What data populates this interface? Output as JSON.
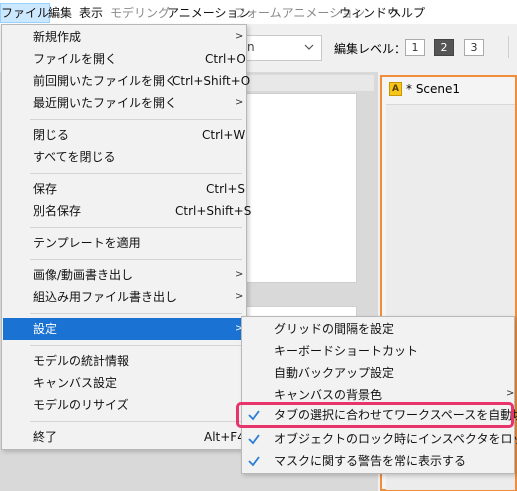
{
  "menubar": {
    "items": [
      {
        "label": "ファイル",
        "state": "active"
      },
      {
        "label": "編集",
        "state": "normal"
      },
      {
        "label": "表示",
        "state": "normal"
      },
      {
        "label": "モデリング",
        "state": "disabled"
      },
      {
        "label": "アニメーション",
        "state": "normal"
      },
      {
        "label": "フォームアニメーション",
        "state": "disabled"
      },
      {
        "label": "ウィンドウ",
        "state": "normal"
      },
      {
        "label": "ヘルプ",
        "state": "normal"
      }
    ]
  },
  "toolbar": {
    "combo_value": "n",
    "edit_level_label": "編集レベル：",
    "levels": [
      "1",
      "2",
      "3"
    ],
    "selected_level": "2"
  },
  "scene_tab": {
    "icon_letter": "A",
    "label": "* Scene1"
  },
  "file_menu": {
    "items": [
      {
        "label": "新規作成",
        "shortcut": "",
        "submenu": true
      },
      {
        "label": "ファイルを開く",
        "shortcut": "Ctrl+O",
        "submenu": false
      },
      {
        "label": "前回開いたファイルを開く",
        "shortcut": "Ctrl+Shift+O",
        "submenu": false
      },
      {
        "label": "最近開いたファイルを開く",
        "shortcut": "",
        "submenu": true
      },
      {
        "label": "閉じる",
        "shortcut": "Ctrl+W",
        "submenu": false
      },
      {
        "label": "すべてを閉じる",
        "shortcut": "",
        "submenu": false
      },
      {
        "label": "保存",
        "shortcut": "Ctrl+S",
        "submenu": false
      },
      {
        "label": "別名保存",
        "shortcut": "Ctrl+Shift+S",
        "submenu": false
      },
      {
        "label": "テンプレートを適用",
        "shortcut": "",
        "submenu": false
      },
      {
        "label": "画像/動画書き出し",
        "shortcut": "",
        "submenu": true
      },
      {
        "label": "組込み用ファイル書き出し",
        "shortcut": "",
        "submenu": true
      },
      {
        "label": "設定",
        "shortcut": "",
        "submenu": true,
        "highlighted": true
      },
      {
        "label": "モデルの統計情報",
        "shortcut": "",
        "submenu": false
      },
      {
        "label": "キャンバス設定",
        "shortcut": "",
        "submenu": false
      },
      {
        "label": "モデルのリサイズ",
        "shortcut": "",
        "submenu": false
      },
      {
        "label": "終了",
        "shortcut": "Alt+F4",
        "submenu": false
      }
    ]
  },
  "settings_submenu": {
    "items": [
      {
        "label": "グリッドの間隔を設定",
        "checked": false,
        "submenu": false
      },
      {
        "label": "キーボードショートカット",
        "checked": false,
        "submenu": false
      },
      {
        "label": "自動バックアップ設定",
        "checked": false,
        "submenu": false
      },
      {
        "label": "キャンバスの背景色",
        "checked": false,
        "submenu": true
      },
      {
        "label": "タブの選択に合わせてワークスペースを自動切替",
        "checked": true,
        "submenu": false,
        "emphasized": true
      },
      {
        "label": "オブジェクトのロック時にインスペクタをロック",
        "checked": true,
        "submenu": false
      },
      {
        "label": "マスクに関する警告を常に表示する",
        "checked": true,
        "submenu": false
      }
    ]
  },
  "colors": {
    "menu_highlight": "#1a72d2",
    "check_blue": "#2a7fd4",
    "emphasis_outline": "#e8336b",
    "scene_border": "#f08d3a"
  }
}
